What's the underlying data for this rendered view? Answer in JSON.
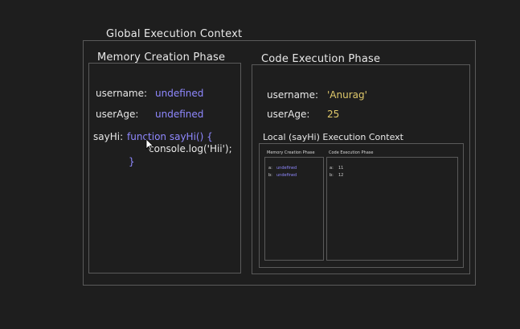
{
  "global_context": {
    "title": "Global Execution Context",
    "memory_phase": {
      "title": "Memory Creation Phase",
      "entries": [
        {
          "key": "username:",
          "value": "undefined"
        },
        {
          "key": "userAge:",
          "value": "undefined"
        }
      ],
      "function_entry": {
        "key": "sayHi:",
        "line1": "function sayHi() {",
        "line2": "console.log('Hii');",
        "line3": "}"
      }
    },
    "code_phase": {
      "title": "Code Execution Phase",
      "entries": [
        {
          "key": "username:",
          "value": "'Anurag'"
        },
        {
          "key": "userAge:",
          "value": "25"
        }
      ],
      "local_context": {
        "title": "Local (sayHi) Execution Context",
        "memory_phase": {
          "title": "Memory Creation Phase",
          "entries": [
            {
              "key": "a:",
              "value": "undefined"
            },
            {
              "key": "b:",
              "value": "undefined"
            }
          ]
        },
        "code_phase": {
          "title": "Code Execution Phase",
          "entries": [
            {
              "key": "a:",
              "value": "11"
            },
            {
              "key": "b:",
              "value": "12"
            }
          ]
        }
      }
    }
  },
  "colors": {
    "background": "#1e1e1e",
    "border": "#5a5a5a",
    "text": "#e8e8e8",
    "keyword": "#8f88ff",
    "string": "#e0c96b"
  }
}
